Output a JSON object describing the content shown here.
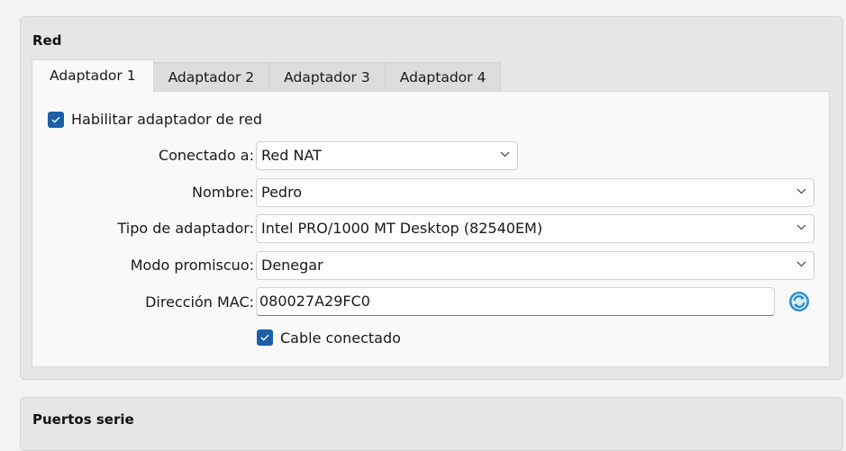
{
  "network": {
    "title": "Red",
    "tabs": [
      "Adaptador 1",
      "Adaptador 2",
      "Adaptador 3",
      "Adaptador 4"
    ],
    "enable_adapter": {
      "label": "Habilitar adaptador de red",
      "checked": true
    },
    "attached_to": {
      "label": "Conectado a:",
      "value": "Red NAT"
    },
    "name": {
      "label": "Nombre:",
      "value": "Pedro"
    },
    "adapter_type": {
      "label": "Tipo de adaptador:",
      "value": "Intel PRO/1000 MT Desktop (82540EM)"
    },
    "promiscuous": {
      "label": "Modo promiscuo:",
      "value": "Denegar"
    },
    "mac": {
      "label": "Dirección MAC:",
      "value": "080027A29FC0"
    },
    "cable": {
      "label": "Cable conectado",
      "checked": true
    }
  },
  "serial": {
    "title": "Puertos serie"
  },
  "colors": {
    "accent": "#1c5fa8",
    "refresh_icon": "#2a8fd6"
  },
  "icons": {
    "checkbox": "check-icon",
    "dropdown": "chevron-down-icon",
    "refresh": "refresh-icon"
  }
}
